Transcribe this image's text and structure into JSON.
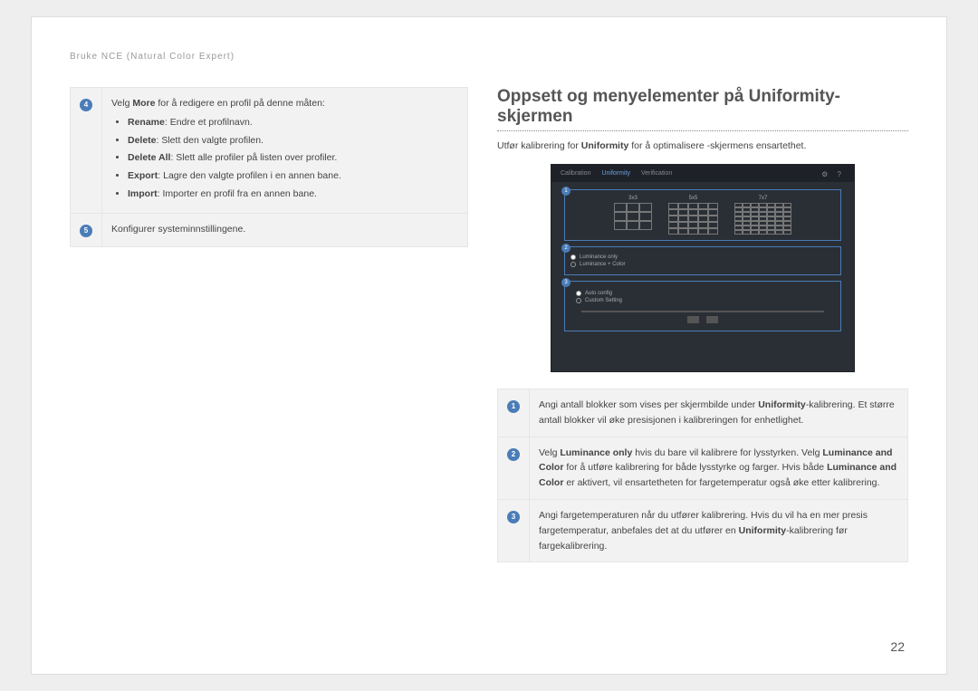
{
  "header": "Bruke NCE (Natural Color Expert)",
  "left": {
    "row4_intro_pre": "Velg ",
    "row4_intro_bold": "More",
    "row4_intro_post": " for å redigere en profil på denne måten:",
    "bullets": [
      {
        "b": "Rename",
        "t": ": Endre et profilnavn."
      },
      {
        "b": "Delete",
        "t": ": Slett den valgte profilen."
      },
      {
        "b": "Delete All",
        "t": ": Slett alle profiler på listen over profiler."
      },
      {
        "b": "Export",
        "t": ": Lagre den valgte profilen i en annen bane."
      },
      {
        "b": "Import",
        "t": ": Importer en profil fra en annen bane."
      }
    ],
    "row5": "Konfigurer systeminnstillingene."
  },
  "right": {
    "heading": "Oppsett og menyelementer på Uniformity-skjermen",
    "desc_pre": "Utfør kalibrering for ",
    "desc_bold": "Uniformity",
    "desc_post": " for å optimalisere -skjermens ensartethet.",
    "ss": {
      "tabs": [
        "Calibration",
        "Uniformity",
        "Verification"
      ],
      "grid_labels": [
        "3x3",
        "5x5",
        "7x7"
      ],
      "radio1": "Luminance only",
      "radio2": "Luminance + Color",
      "r3_a": "Auto config",
      "r3_b": "Custom Setting"
    },
    "items": [
      {
        "n": "1",
        "parts": [
          {
            "t": "Angi antall blokker som vises per skjermbilde under "
          },
          {
            "b": "Uniformity"
          },
          {
            "t": "-kalibrering. Et større antall blokker vil øke presisjonen i kalibreringen for enhetlighet."
          }
        ]
      },
      {
        "n": "2",
        "parts": [
          {
            "t": "Velg "
          },
          {
            "b": "Luminance only"
          },
          {
            "t": " hvis du bare vil kalibrere for lysstyrken. Velg "
          },
          {
            "b": "Luminance and Color"
          },
          {
            "t": " for å utføre kalibrering for både lysstyrke og farger. Hvis både "
          },
          {
            "b": "Luminance and Color"
          },
          {
            "t": " er aktivert, vil ensartetheten for fargetemperatur også øke etter kalibrering."
          }
        ]
      },
      {
        "n": "3",
        "parts": [
          {
            "t": "Angi fargetemperaturen når du utfører kalibrering. Hvis du vil ha en mer presis fargetemperatur, anbefales det at du utfører en "
          },
          {
            "b": "Uniformity"
          },
          {
            "t": "-kalibrering før fargekalibrering."
          }
        ]
      }
    ]
  },
  "page_number": "22"
}
